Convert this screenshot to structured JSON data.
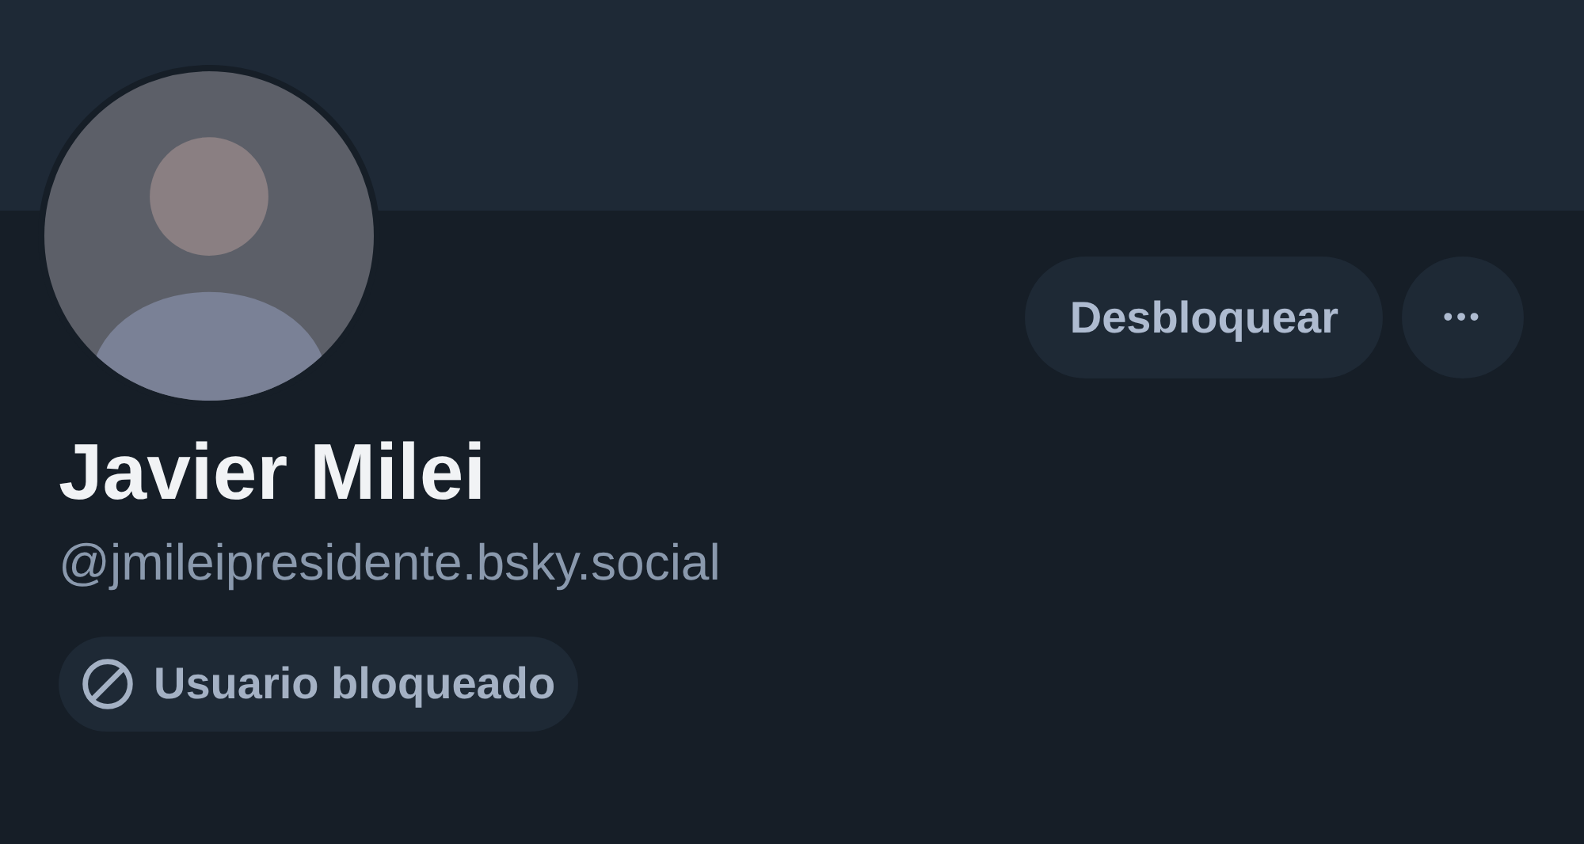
{
  "profile": {
    "display_name": "Javier Milei",
    "handle": "@jmileipresidente.bsky.social",
    "blocked": true
  },
  "actions": {
    "unblock_label": "Desbloquear",
    "more_label": "•••"
  },
  "badge": {
    "label": "Usuario bloqueado"
  }
}
